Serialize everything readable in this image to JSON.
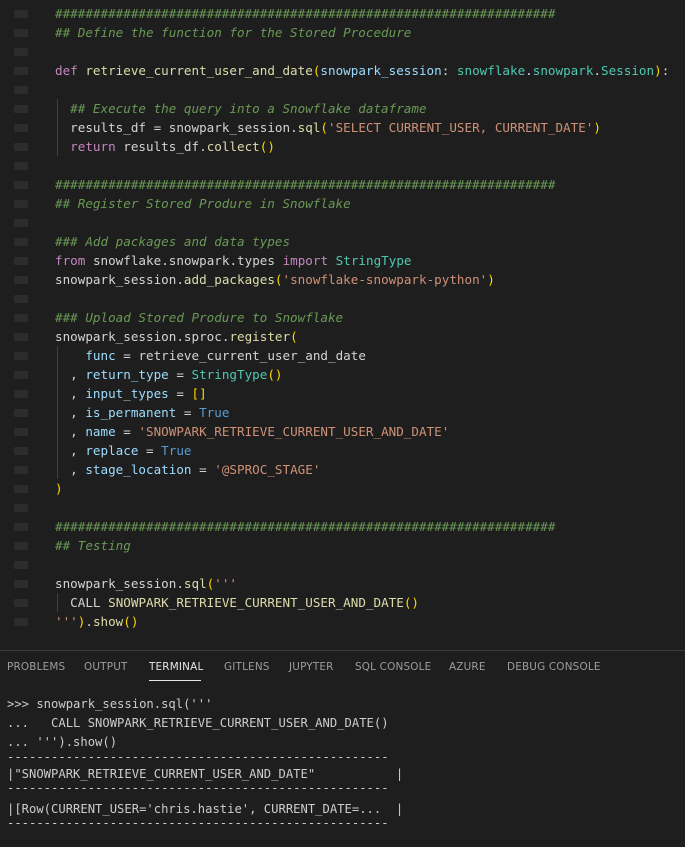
{
  "code": {
    "lines": [
      "##################################################################",
      "## Define the function for the Stored Procedure",
      "",
      "def retrieve_current_user_and_date(snowpark_session: snowflake.snowpark.Session):",
      "",
      "  ## Execute the query into a Snowflake dataframe",
      "  results_df = snowpark_session.sql('SELECT CURRENT_USER, CURRENT_DATE')",
      "  return results_df.collect()",
      "",
      "##################################################################",
      "## Register Stored Produre in Snowflake",
      "",
      "### Add packages and data types",
      "from snowflake.snowpark.types import StringType",
      "snowpark_session.add_packages('snowflake-snowpark-python')",
      "",
      "### Upload Stored Produre to Snowflake",
      "snowpark_session.sproc.register(",
      "    func = retrieve_current_user_and_date",
      "  , return_type = StringType()",
      "  , input_types = []",
      "  , is_permanent = True",
      "  , name = 'SNOWPARK_RETRIEVE_CURRENT_USER_AND_DATE'",
      "  , replace = True",
      "  , stage_location = '@SPROC_STAGE'",
      ")",
      "",
      "##################################################################",
      "## Testing",
      "",
      "snowpark_session.sql('''",
      "  CALL SNOWPARK_RETRIEVE_CURRENT_USER_AND_DATE()",
      "''').show()"
    ]
  },
  "panel": {
    "tabs": [
      "PROBLEMS",
      "OUTPUT",
      "TERMINAL",
      "GITLENS",
      "JUPYTER",
      "SQL CONSOLE",
      "AZURE",
      "DEBUG CONSOLE"
    ],
    "active_tab": "TERMINAL"
  },
  "terminal": {
    "lines": [
      ">>> snowpark_session.sql('''",
      "...   CALL SNOWPARK_RETRIEVE_CURRENT_USER_AND_DATE()",
      "... ''').show()",
      "----------------------------------------------------",
      "|\"SNOWPARK_RETRIEVE_CURRENT_USER_AND_DATE\"           |",
      "----------------------------------------------------",
      "|[Row(CURRENT_USER='chris.hastie', CURRENT_DATE=...  |",
      "----------------------------------------------------"
    ]
  },
  "colors": {
    "background": "#1e1e1e",
    "comment": "#6a9955",
    "keyword": "#c586c0",
    "function": "#dcdcaa",
    "string": "#ce9178",
    "boolean": "#569cd6",
    "param": "#9cdcfe"
  }
}
